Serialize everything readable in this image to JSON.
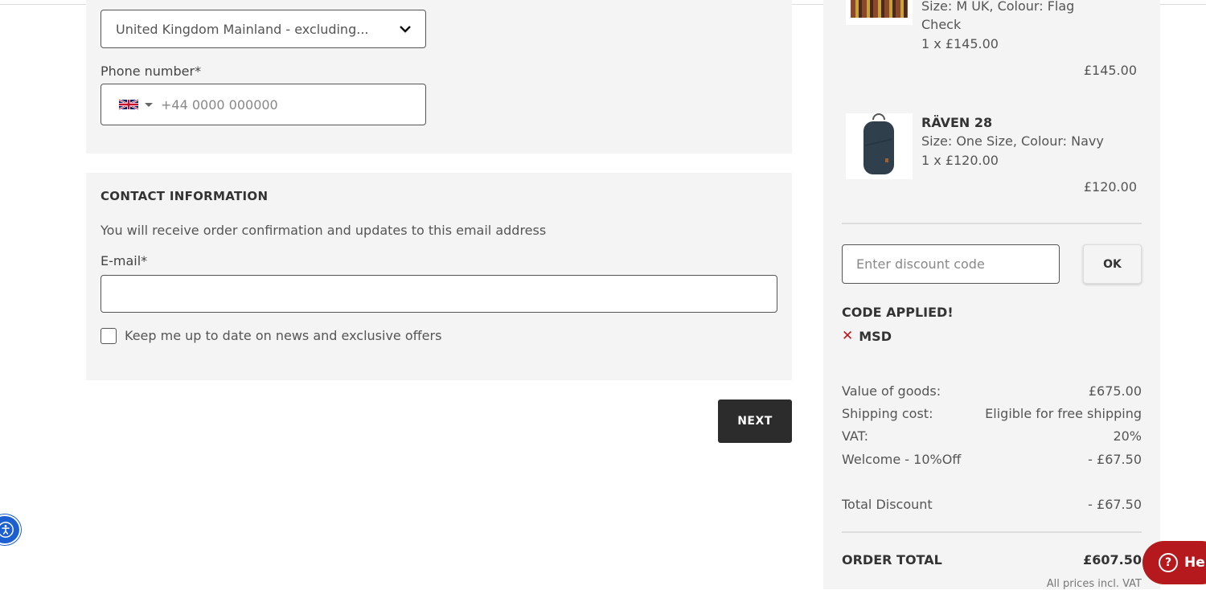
{
  "shipping": {
    "country_select": "United Kingdom Mainland - excluding...",
    "phone_label": "Phone number*",
    "phone_placeholder": "+44 0000 000000"
  },
  "contact": {
    "title": "CONTACT INFORMATION",
    "description": "You will receive order confirmation and updates to this email address",
    "email_label": "E-mail*",
    "email_value": "",
    "newsletter_label": "Keep me up to date on news and exclusive offers",
    "newsletter_checked": false
  },
  "next_label": "NEXT",
  "cart": {
    "items": [
      {
        "name": "",
        "details_line": "Size:  M UK,  Colour:  Flag",
        "details_cont": "Check",
        "qty_price": "1 x £145.00",
        "total": "£145.00"
      },
      {
        "name": "RÄVEN 28",
        "details_line": "Size:  One Size,  Colour:  Navy",
        "qty_price": "1 x £120.00",
        "total": "£120.00"
      }
    ],
    "discount_placeholder": "Enter discount code",
    "ok_label": "OK",
    "code_applied": "CODE APPLIED!",
    "applied_code": "MSD",
    "rows": [
      {
        "label": "Value of goods:",
        "value": "£675.00"
      },
      {
        "label": "Shipping cost:",
        "value": "Eligible for free shipping"
      },
      {
        "label": "VAT:",
        "value": "20%"
      },
      {
        "label": "Welcome - 10%Off",
        "value": "- £67.50"
      }
    ],
    "total_discount_label": "Total Discount",
    "total_discount_value": "- £67.50",
    "order_total_label": "ORDER TOTAL",
    "order_total_value": "£607.50",
    "vat_note": "All prices incl. VAT"
  },
  "help_label": "He",
  "colors": {
    "accent": "#b5191e",
    "button": "#2c2c2c",
    "panel": "#f4f4f4",
    "remove": "#c0141b"
  }
}
